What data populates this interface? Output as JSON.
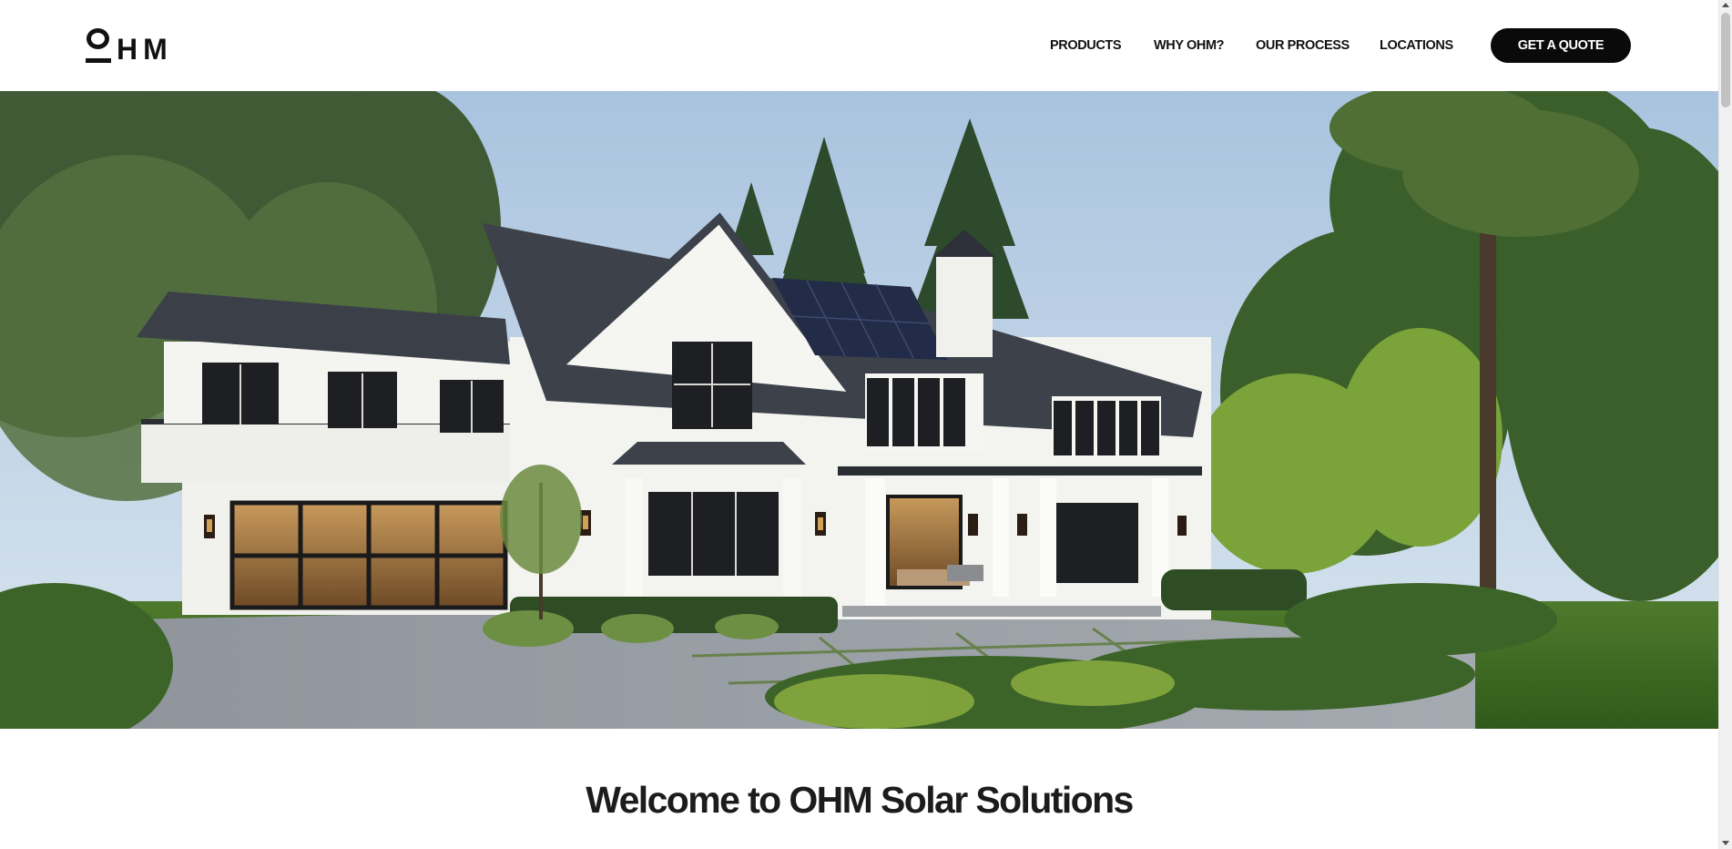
{
  "brand": {
    "logo_text": "HM",
    "logo_alt": "OHM"
  },
  "nav": {
    "items": [
      {
        "label": "PRODUCTS"
      },
      {
        "label": "WHY OHM?"
      },
      {
        "label": "OUR PROCESS"
      },
      {
        "label": "LOCATIONS"
      }
    ],
    "cta_label": "GET A QUOTE"
  },
  "hero": {
    "image_description_icon": "house-with-solar-panels-image"
  },
  "welcome": {
    "heading": "Welcome to OHM Solar Solutions"
  },
  "colors": {
    "primary": "#0a0a0a",
    "background": "#ffffff",
    "text": "#1c1c1c"
  }
}
